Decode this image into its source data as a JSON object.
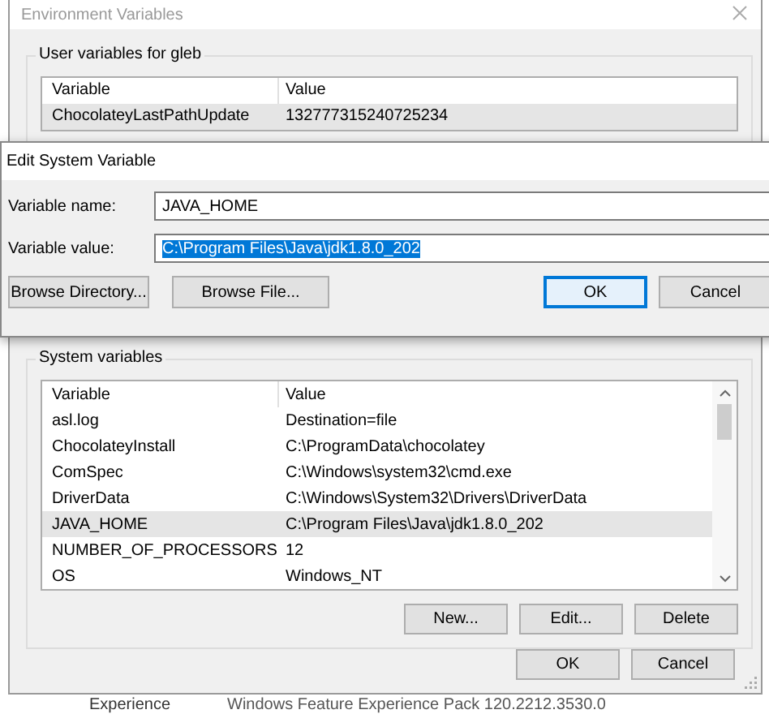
{
  "environment_window": {
    "title": "Environment Variables",
    "user_variables": {
      "title": "User variables for gleb",
      "columns": [
        "Variable",
        "Value"
      ],
      "rows": [
        {
          "variable": "ChocolateyLastPathUpdate",
          "value": "132777315240725234",
          "selected": true
        }
      ]
    },
    "system_variables": {
      "title": "System variables",
      "columns": [
        "Variable",
        "Value"
      ],
      "rows": [
        {
          "variable": "asl.log",
          "value": "Destination=file",
          "selected": false
        },
        {
          "variable": "ChocolateyInstall",
          "value": "C:\\ProgramData\\chocolatey",
          "selected": false
        },
        {
          "variable": "ComSpec",
          "value": "C:\\Windows\\system32\\cmd.exe",
          "selected": false
        },
        {
          "variable": "DriverData",
          "value": "C:\\Windows\\System32\\Drivers\\DriverData",
          "selected": false
        },
        {
          "variable": "JAVA_HOME",
          "value": "C:\\Program Files\\Java\\jdk1.8.0_202",
          "selected": true
        },
        {
          "variable": "NUMBER_OF_PROCESSORS",
          "value": "12",
          "selected": false
        },
        {
          "variable": "OS",
          "value": "Windows_NT",
          "selected": false
        }
      ],
      "buttons": [
        "New...",
        "Edit...",
        "Delete"
      ]
    },
    "buttons": [
      "OK",
      "Cancel"
    ]
  },
  "edit_dialog": {
    "title": "Edit System Variable",
    "fields": [
      {
        "label": "Variable name:",
        "value": "JAVA_HOME",
        "text_selected": false
      },
      {
        "label": "Variable value:",
        "value": "C:\\Program Files\\Java\\jdk1.8.0_202",
        "text_selected": true
      }
    ],
    "buttons": [
      {
        "label": "Browse Directory...",
        "focused": false
      },
      {
        "label": "Browse File...",
        "focused": false
      },
      {
        "label": "OK",
        "focused": true
      },
      {
        "label": "Cancel",
        "focused": false
      }
    ]
  },
  "background_row": {
    "label": "Experience",
    "value": "Windows Feature Experience Pack 120.2212.3530.0"
  }
}
